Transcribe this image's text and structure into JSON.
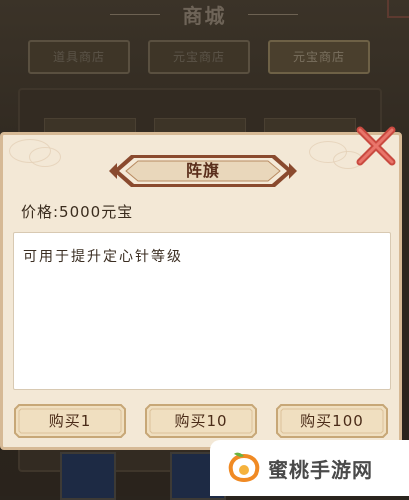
{
  "shop": {
    "title": "商城",
    "tabs": [
      {
        "label": "道具商店"
      },
      {
        "label": "元宝商店"
      },
      {
        "label": "元宝商店"
      }
    ]
  },
  "dialog": {
    "title": "阵旗",
    "price": "价格:5000元宝",
    "description": "可用于提升定心针等级",
    "buttons": [
      {
        "label": "购买1"
      },
      {
        "label": "购买10"
      },
      {
        "label": "购买100"
      }
    ],
    "close_icon": "close-x-icon"
  },
  "watermark": {
    "text": "蜜桃手游网",
    "icon": "peach-logo-icon"
  },
  "colors": {
    "dialog_bg": "#f3e8d6",
    "banner": "#8a4a2e",
    "close": "#d9534a",
    "button_bg": "#f0dfc0",
    "button_border": "#c7a777"
  }
}
